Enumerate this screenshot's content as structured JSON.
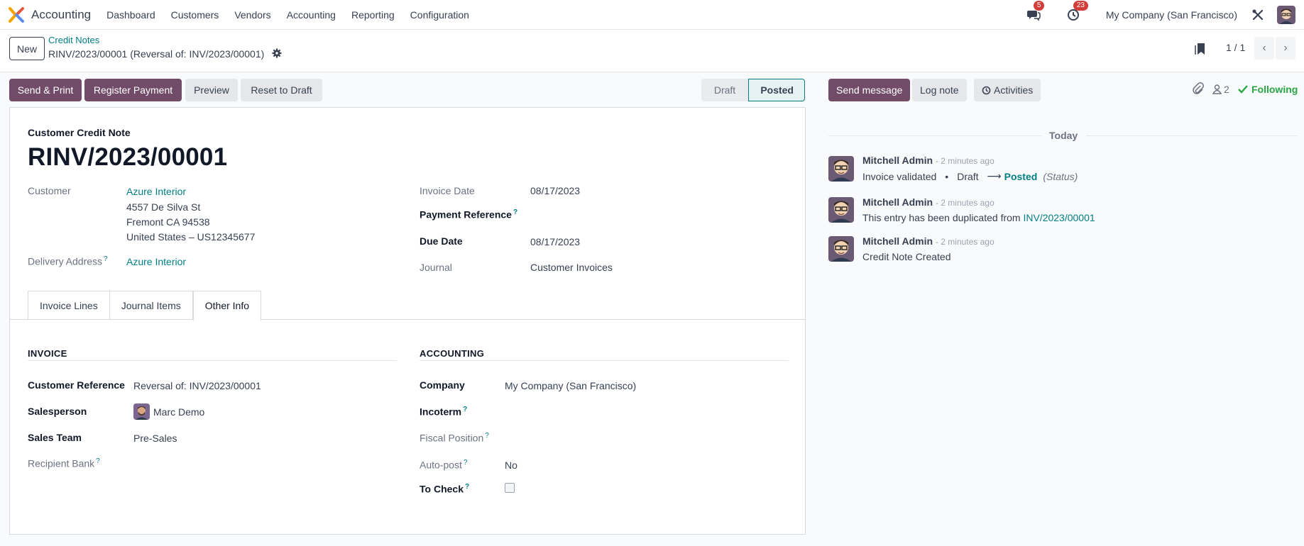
{
  "nav": {
    "app_name": "Accounting",
    "menu": [
      "Dashboard",
      "Customers",
      "Vendors",
      "Accounting",
      "Reporting",
      "Configuration"
    ],
    "messages_count": "5",
    "activities_count": "23",
    "company": "My Company (San Francisco)"
  },
  "control": {
    "new_label": "New",
    "breadcrumb_parent": "Credit Notes",
    "breadcrumb_current": "RINV/2023/00001 (Reversal of: INV/2023/00001)",
    "pager": "1 / 1"
  },
  "actions": {
    "send_print": "Send & Print",
    "register_payment": "Register Payment",
    "preview": "Preview",
    "reset_to_draft": "Reset to Draft"
  },
  "status": {
    "draft": "Draft",
    "posted": "Posted"
  },
  "form": {
    "doc_type": "Customer Credit Note",
    "doc_name": "RINV/2023/00001",
    "customer_label": "Customer",
    "customer_name": "Azure Interior",
    "address_line1": "4557 De Silva St",
    "address_line2": "Fremont CA 94538",
    "address_line3": "United States – US12345677",
    "delivery_label": "Delivery Address",
    "delivery_value": "Azure Interior",
    "invoice_date_label": "Invoice Date",
    "invoice_date": "08/17/2023",
    "payment_ref_label": "Payment Reference",
    "due_date_label": "Due Date",
    "due_date": "08/17/2023",
    "journal_label": "Journal",
    "journal": "Customer Invoices"
  },
  "tabs": [
    "Invoice Lines",
    "Journal Items",
    "Other Info"
  ],
  "other_info": {
    "invoice_title": "INVOICE",
    "customer_ref_label": "Customer Reference",
    "customer_ref": "Reversal of: INV/2023/00001",
    "salesperson_label": "Salesperson",
    "salesperson": "Marc Demo",
    "sales_team_label": "Sales Team",
    "sales_team": "Pre-Sales",
    "recipient_bank_label": "Recipient Bank",
    "accounting_title": "ACCOUNTING",
    "company_label": "Company",
    "company": "My Company (San Francisco)",
    "incoterm_label": "Incoterm",
    "fiscal_position_label": "Fiscal Position",
    "autopost_label": "Auto-post",
    "autopost": "No",
    "to_check_label": "To Check",
    "help_mark": "?"
  },
  "chatter": {
    "send_message": "Send message",
    "log_note": "Log note",
    "activities": "Activities",
    "followers_count": "2",
    "following": "Following",
    "today": "Today",
    "messages": [
      {
        "author": "Mitchell Admin",
        "time": "- 2 minutes ago",
        "body_prefix": "Invoice validated",
        "from": "Draft",
        "to": "Posted",
        "field": "(Status)"
      },
      {
        "author": "Mitchell Admin",
        "time": "- 2 minutes ago",
        "body_prefix": "This entry has been duplicated from",
        "link": "INV/2023/00001"
      },
      {
        "author": "Mitchell Admin",
        "time": "- 2 minutes ago",
        "body_prefix": "Credit Note Created"
      }
    ]
  },
  "colors": {
    "brand": "#714b67",
    "link": "#017e84",
    "badge": "#d23f3a",
    "following": "#28a745"
  }
}
